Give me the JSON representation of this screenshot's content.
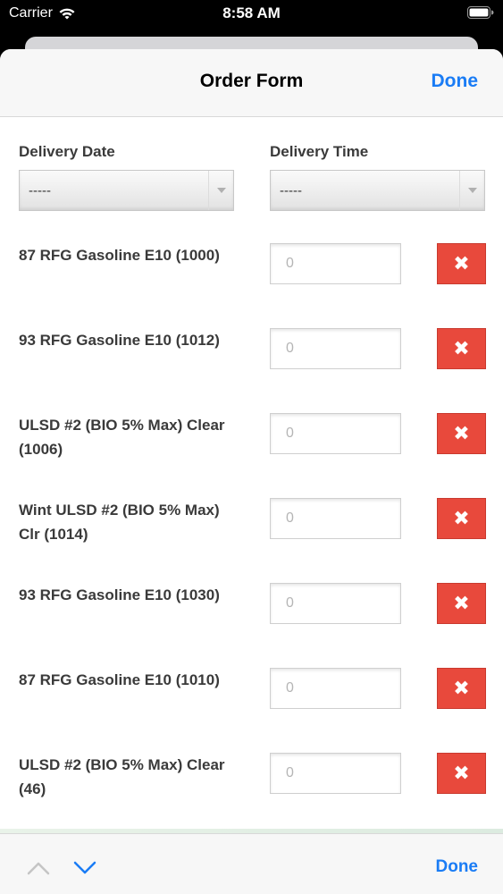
{
  "status_bar": {
    "carrier": "Carrier",
    "time": "8:58 AM"
  },
  "nav": {
    "title": "Order Form",
    "done_label": "Done"
  },
  "delivery": {
    "date_label": "Delivery Date",
    "date_value": "-----",
    "time_label": "Delivery Time",
    "time_value": "-----"
  },
  "products": [
    {
      "name": "87 RFG Gasoline E10 (1000)",
      "placeholder": "0"
    },
    {
      "name": "93 RFG Gasoline E10 (1012)",
      "placeholder": "0"
    },
    {
      "name": "ULSD #2 (BIO 5% Max) Clear (1006)",
      "placeholder": "0"
    },
    {
      "name": "Wint ULSD #2 (BIO 5% Max) Clr (1014)",
      "placeholder": "0"
    },
    {
      "name": "93 RFG Gasoline E10 (1030)",
      "placeholder": "0"
    },
    {
      "name": "87 RFG Gasoline E10 (1010)",
      "placeholder": "0"
    },
    {
      "name": "ULSD #2 (BIO 5% Max) Clear (46)",
      "placeholder": "0"
    }
  ],
  "remove_icon": "✖",
  "toolbar": {
    "done_label": "Done"
  },
  "colors": {
    "accent": "#1a7cf5",
    "remove": "#e8493c"
  }
}
